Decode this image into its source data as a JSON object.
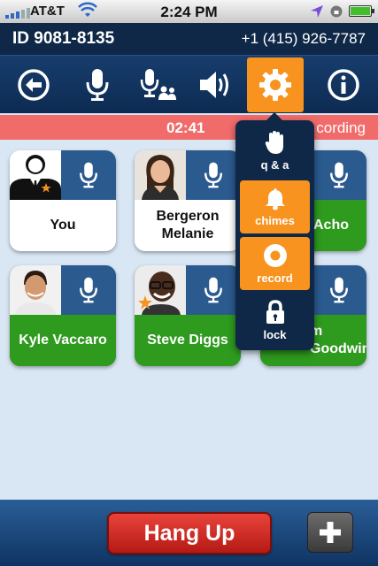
{
  "status_bar": {
    "carrier": "AT&T",
    "time": "2:24 PM"
  },
  "header": {
    "conference_id": "ID 9081-8135",
    "phone_number": "+1 (415) 926-7787"
  },
  "toolbar": {
    "buttons": [
      {
        "icon": "back-arrow-icon"
      },
      {
        "icon": "microphone-icon"
      },
      {
        "icon": "mic-participants-icon"
      },
      {
        "icon": "speaker-icon"
      },
      {
        "icon": "gear-icon",
        "active": true
      },
      {
        "icon": "info-icon"
      }
    ]
  },
  "recording_bar": {
    "timer": "02:41",
    "label": "cording"
  },
  "participants": [
    {
      "name": "You",
      "style": "white"
    },
    {
      "name": "Bergeron Melanie",
      "style": "white"
    },
    {
      "name": "Acho",
      "style": "green"
    },
    {
      "name": "Kyle Vaccaro",
      "style": "green"
    },
    {
      "name": "Steve Diggs",
      "style": "green"
    },
    {
      "name": "m Goodwin",
      "style": "green"
    }
  ],
  "settings_menu": {
    "items": [
      {
        "label": "q & a",
        "icon": "raised-hand-icon",
        "active": false
      },
      {
        "label": "chimes",
        "icon": "bell-icon",
        "active": true
      },
      {
        "label": "record",
        "icon": "record-icon",
        "active": true
      },
      {
        "label": "lock",
        "icon": "lock-icon",
        "active": false
      }
    ]
  },
  "bottom_bar": {
    "hang_up_label": "Hang Up",
    "add_icon": "plus-icon"
  },
  "colors": {
    "navy": "#0f2847",
    "accent_orange": "#f7931e",
    "recording_red": "#f26b6b",
    "tile_green": "#2e9a1e",
    "mic_blue": "#2b5a8f",
    "hangup_red": "#c9231b"
  }
}
